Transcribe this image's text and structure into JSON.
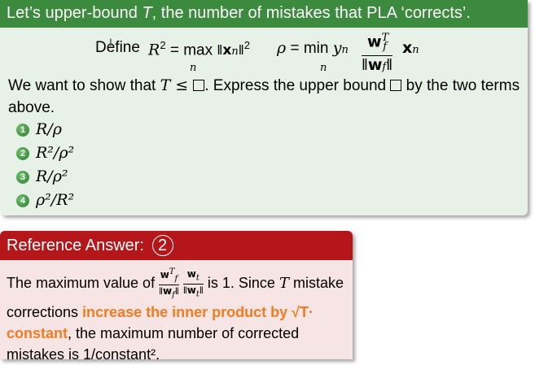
{
  "question": {
    "title_pre": "Let’s upper-bound ",
    "title_var": "T",
    "title_post": ", the number of mistakes that PLA ‘corrects’.",
    "define_word": "Define",
    "prompt_a": "We want to show that ",
    "prompt_b": "T ≤ ",
    "prompt_c": ". Express the upper bound ",
    "prompt_d": " by the two terms above.",
    "options": [
      {
        "num": "1",
        "text": "R/ρ"
      },
      {
        "num": "2",
        "text": "R²/ρ²"
      },
      {
        "num": "3",
        "text": "R/ρ²"
      },
      {
        "num": "4",
        "text": "ρ²/R²"
      }
    ]
  },
  "answer": {
    "title": "Reference Answer:",
    "choice": "2",
    "text_1": "The maximum value of ",
    "text_2": " is 1. Since ",
    "text_T": "T",
    "text_3": " mistake corrections ",
    "hl_1": "increase the inner product by ",
    "hl_2": "√T",
    "hl_3": "· constant",
    "text_4": ", the maximum number of corrected mistakes is 1/constant²."
  },
  "colors": {
    "question_header": "#3b8a3e",
    "question_bg": "#e8f1e8",
    "answer_header": "#b5161a",
    "answer_bg": "#f7e4e4",
    "highlight": "#f47b20"
  }
}
